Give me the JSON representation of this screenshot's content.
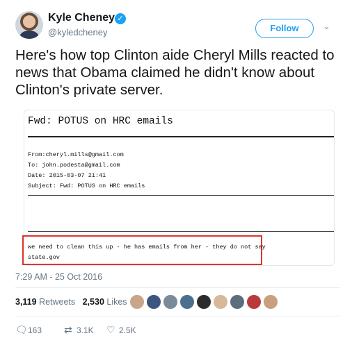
{
  "author": {
    "name": "Kyle Cheney",
    "handle": "@kyledcheney",
    "verified_mark": "✓"
  },
  "follow_label": "Follow",
  "caret": "⌄",
  "tweet_text": "Here's how top Clinton aide Cheryl Mills reacted to news that Obama claimed he didn't know about Clinton's private server.",
  "email": {
    "subject_line": "Fwd: POTUS on HRC emails",
    "from": "From:cheryl.mills@gmail.com",
    "to": "To: john.podesta@gmail.com",
    "date": "Date: 2015-03-07 21:41",
    "subject": "Subject: Fwd: POTUS on HRC emails",
    "body_line1": "we need to clean this up - he has emails from her - they do not say",
    "body_line2": "state.gov"
  },
  "timestamp": "7:29 AM - 25 Oct 2016",
  "stats": {
    "retweets_count": "3,119",
    "retweets_label": "Retweets",
    "likes_count": "2,530",
    "likes_label": "Likes"
  },
  "actions": {
    "reply_count": "163",
    "retweet_count": "3.1K",
    "like_count": "2.5K"
  },
  "colors": {
    "accent": "#1da1f2",
    "highlight_box": "#e0352b",
    "muted_text": "#657786"
  }
}
